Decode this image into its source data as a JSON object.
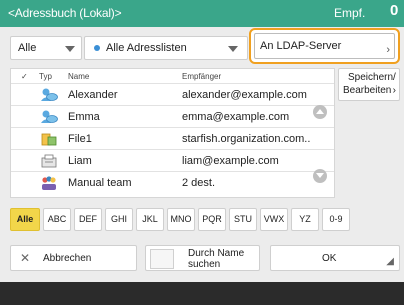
{
  "header": {
    "title": "<Adressbuch (Lokal)>",
    "recipients_label": "Empf.",
    "recipients_count": "0"
  },
  "filters": {
    "type_select": "Alle",
    "list_select": "Alle Adresslisten",
    "ldap_button": "An LDAP-Server"
  },
  "table": {
    "columns": {
      "check": "✓",
      "type": "Typ",
      "name": "Name",
      "recipient": "Empfänger"
    },
    "rows": [
      {
        "icon": "email-contact-icon",
        "name": "Alexander",
        "address": "alexander@example.com"
      },
      {
        "icon": "email-contact-icon",
        "name": "Emma",
        "address": "emma@example.com"
      },
      {
        "icon": "file-server-icon",
        "name": "File1",
        "address": "starfish.organization.com.."
      },
      {
        "icon": "fax-icon",
        "name": "Liam",
        "address": "liam@example.com"
      },
      {
        "icon": "group-icon",
        "name": "Manual team",
        "address": "2 dest."
      }
    ]
  },
  "side_button": {
    "line1": "Speichern/",
    "line2": "Bearbeiten"
  },
  "alpha_tabs": [
    "Alle",
    "ABC",
    "DEF",
    "GHI",
    "JKL",
    "MNO",
    "PQR",
    "STU",
    "VWX",
    "YZ",
    "0-9"
  ],
  "bottom": {
    "cancel": "Abbrechen",
    "name_search_line1": "Durch Name",
    "name_search_line2": "suchen",
    "ok": "OK"
  },
  "colors": {
    "header": "#3aa68a",
    "highlight": "#f0a020",
    "active_tab": "#f2d64a"
  }
}
